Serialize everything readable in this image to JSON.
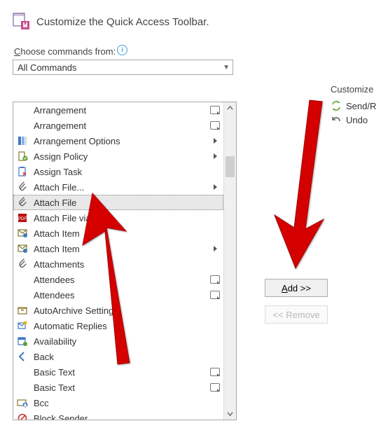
{
  "header": {
    "title": "Customize the Quick Access Toolbar."
  },
  "choose_label_pre": "C",
  "choose_label_rest": "hoose commands from:",
  "combo": {
    "value": "All Commands"
  },
  "commands": [
    {
      "icon": "",
      "label": "Arrangement",
      "tail": "box"
    },
    {
      "icon": "",
      "label": "Arrangement",
      "tail": "box"
    },
    {
      "icon": "arrangement-options",
      "label": "Arrangement Options",
      "tail": "sub"
    },
    {
      "icon": "assign-policy",
      "label": "Assign Policy",
      "tail": "sub"
    },
    {
      "icon": "assign-task",
      "label": "Assign Task",
      "tail": ""
    },
    {
      "icon": "attach",
      "label": "Attach File...",
      "tail": "sub"
    },
    {
      "icon": "attach",
      "label": "Attach File",
      "tail": "",
      "selected": true
    },
    {
      "icon": "pdf",
      "label": "Attach File via Link",
      "tail": ""
    },
    {
      "icon": "attach-item",
      "label": "Attach Item",
      "tail": ""
    },
    {
      "icon": "attach-item",
      "label": "Attach Item",
      "tail": "sub"
    },
    {
      "icon": "attach",
      "label": "Attachments",
      "tail": ""
    },
    {
      "icon": "",
      "label": "Attendees",
      "tail": "box"
    },
    {
      "icon": "",
      "label": "Attendees",
      "tail": "box"
    },
    {
      "icon": "archive",
      "label": "AutoArchive Settings",
      "tail": ""
    },
    {
      "icon": "auto-reply",
      "label": "Automatic Replies",
      "tail": ""
    },
    {
      "icon": "availability",
      "label": "Availability",
      "tail": ""
    },
    {
      "icon": "back",
      "label": "Back",
      "tail": ""
    },
    {
      "icon": "",
      "label": "Basic Text",
      "tail": "box"
    },
    {
      "icon": "",
      "label": "Basic Text",
      "tail": "box"
    },
    {
      "icon": "bcc",
      "label": "Bcc",
      "tail": ""
    },
    {
      "icon": "block",
      "label": "Block Sender",
      "tail": ""
    }
  ],
  "right": {
    "title": "Customize ",
    "items": [
      {
        "icon": "sendreceive",
        "label": "Send/R"
      },
      {
        "icon": "undo",
        "label": "Undo"
      }
    ]
  },
  "buttons": {
    "add": "Add >>",
    "remove": "<< Remove",
    "add_underline": "A"
  }
}
